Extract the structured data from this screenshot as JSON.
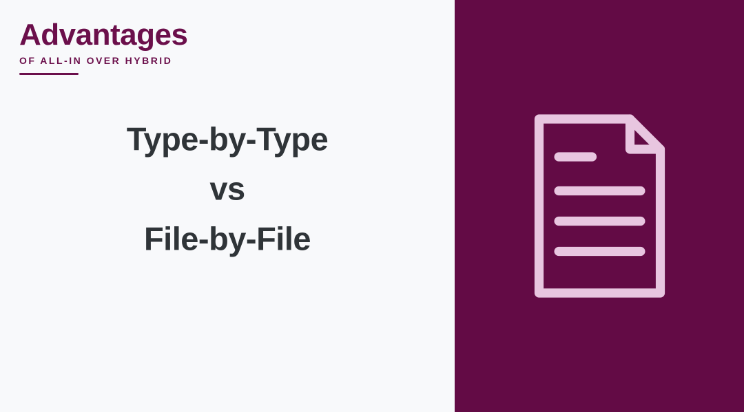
{
  "header": {
    "title": "Advantages",
    "subtitle": "OF ALL-IN OVER HYBRID"
  },
  "content": {
    "line1": "Type-by-Type",
    "line2": "vs",
    "line3": "File-by-File"
  },
  "icon": {
    "name": "document-icon"
  },
  "colors": {
    "brand": "#6b0f4b",
    "panel": "#630b45",
    "icon_stroke": "#e8c6e0",
    "text_dark": "#2f3438",
    "bg_light": "#f8f9fb"
  }
}
